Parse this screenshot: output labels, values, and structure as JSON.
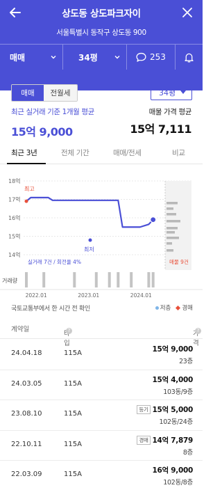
{
  "header": {
    "title": "상도동 상도파크자이",
    "address": "서울특별시 동작구 상도동 900",
    "trade_type": "매매",
    "size": "34평",
    "comment_count": "253"
  },
  "toggle": {
    "sale": "매매",
    "rent": "전월세"
  },
  "size_select": "34평",
  "summary": {
    "avg_label": "최근 실거래 기준 1개월 평균",
    "avg_value": "15억 9,000",
    "ask_label": "매물 가격 평균",
    "ask_value": "15억 7,111"
  },
  "tabs": [
    "최근 3년",
    "전체 기간",
    "매매/전세",
    "비교"
  ],
  "chart_labels": {
    "high": "최고",
    "low": "최저",
    "stats": "실거래 7건 / 회전율 4%",
    "listing": "매물 9건",
    "volume": "거래량"
  },
  "chart_data": {
    "type": "line",
    "ylim": [
      14,
      18
    ],
    "yticks": [
      "18억",
      "17억",
      "16억",
      "15억",
      "14억"
    ],
    "xticks": [
      "2022.01",
      "2023.01",
      "2024.01"
    ],
    "series": [
      {
        "x": [
          "2021.11",
          "2021.12",
          "2022.02",
          "2022.04",
          "2022.05",
          "2022.10",
          "2023.01",
          "2023.06",
          "2023.08",
          "2023.09",
          "2023.10",
          "2024.01",
          "2024.03",
          "2024.04"
        ],
        "values": [
          16.9,
          17.1,
          17.1,
          17.1,
          16.95,
          16.95,
          16.95,
          16.95,
          16.95,
          15.5,
          15.5,
          15.5,
          15.65,
          15.9
        ]
      }
    ]
  },
  "source_note": "국토교통부에서 한 시간 전 확인",
  "legend": {
    "low_floor": "저층",
    "auction": "경매"
  },
  "table": {
    "headers": {
      "date": "계약일",
      "type": "타입",
      "price": "가격"
    },
    "rows": [
      {
        "date": "24.04.18",
        "type": "115A",
        "tag": "",
        "price": "15억 9,000",
        "floor": "23층"
      },
      {
        "date": "24.03.05",
        "type": "115A",
        "tag": "",
        "price": "15억 4,000",
        "floor": "103동/9층"
      },
      {
        "date": "23.08.10",
        "type": "115A",
        "tag": "등기",
        "price": "15억 5,000",
        "floor": "102동/24층"
      },
      {
        "date": "22.10.11",
        "type": "115A",
        "tag": "경매",
        "price": "14억 7,879",
        "floor": "8층"
      },
      {
        "date": "22.03.09",
        "type": "115A",
        "tag": "",
        "price": "16억 9,000",
        "floor": "102동/8층"
      }
    ]
  }
}
